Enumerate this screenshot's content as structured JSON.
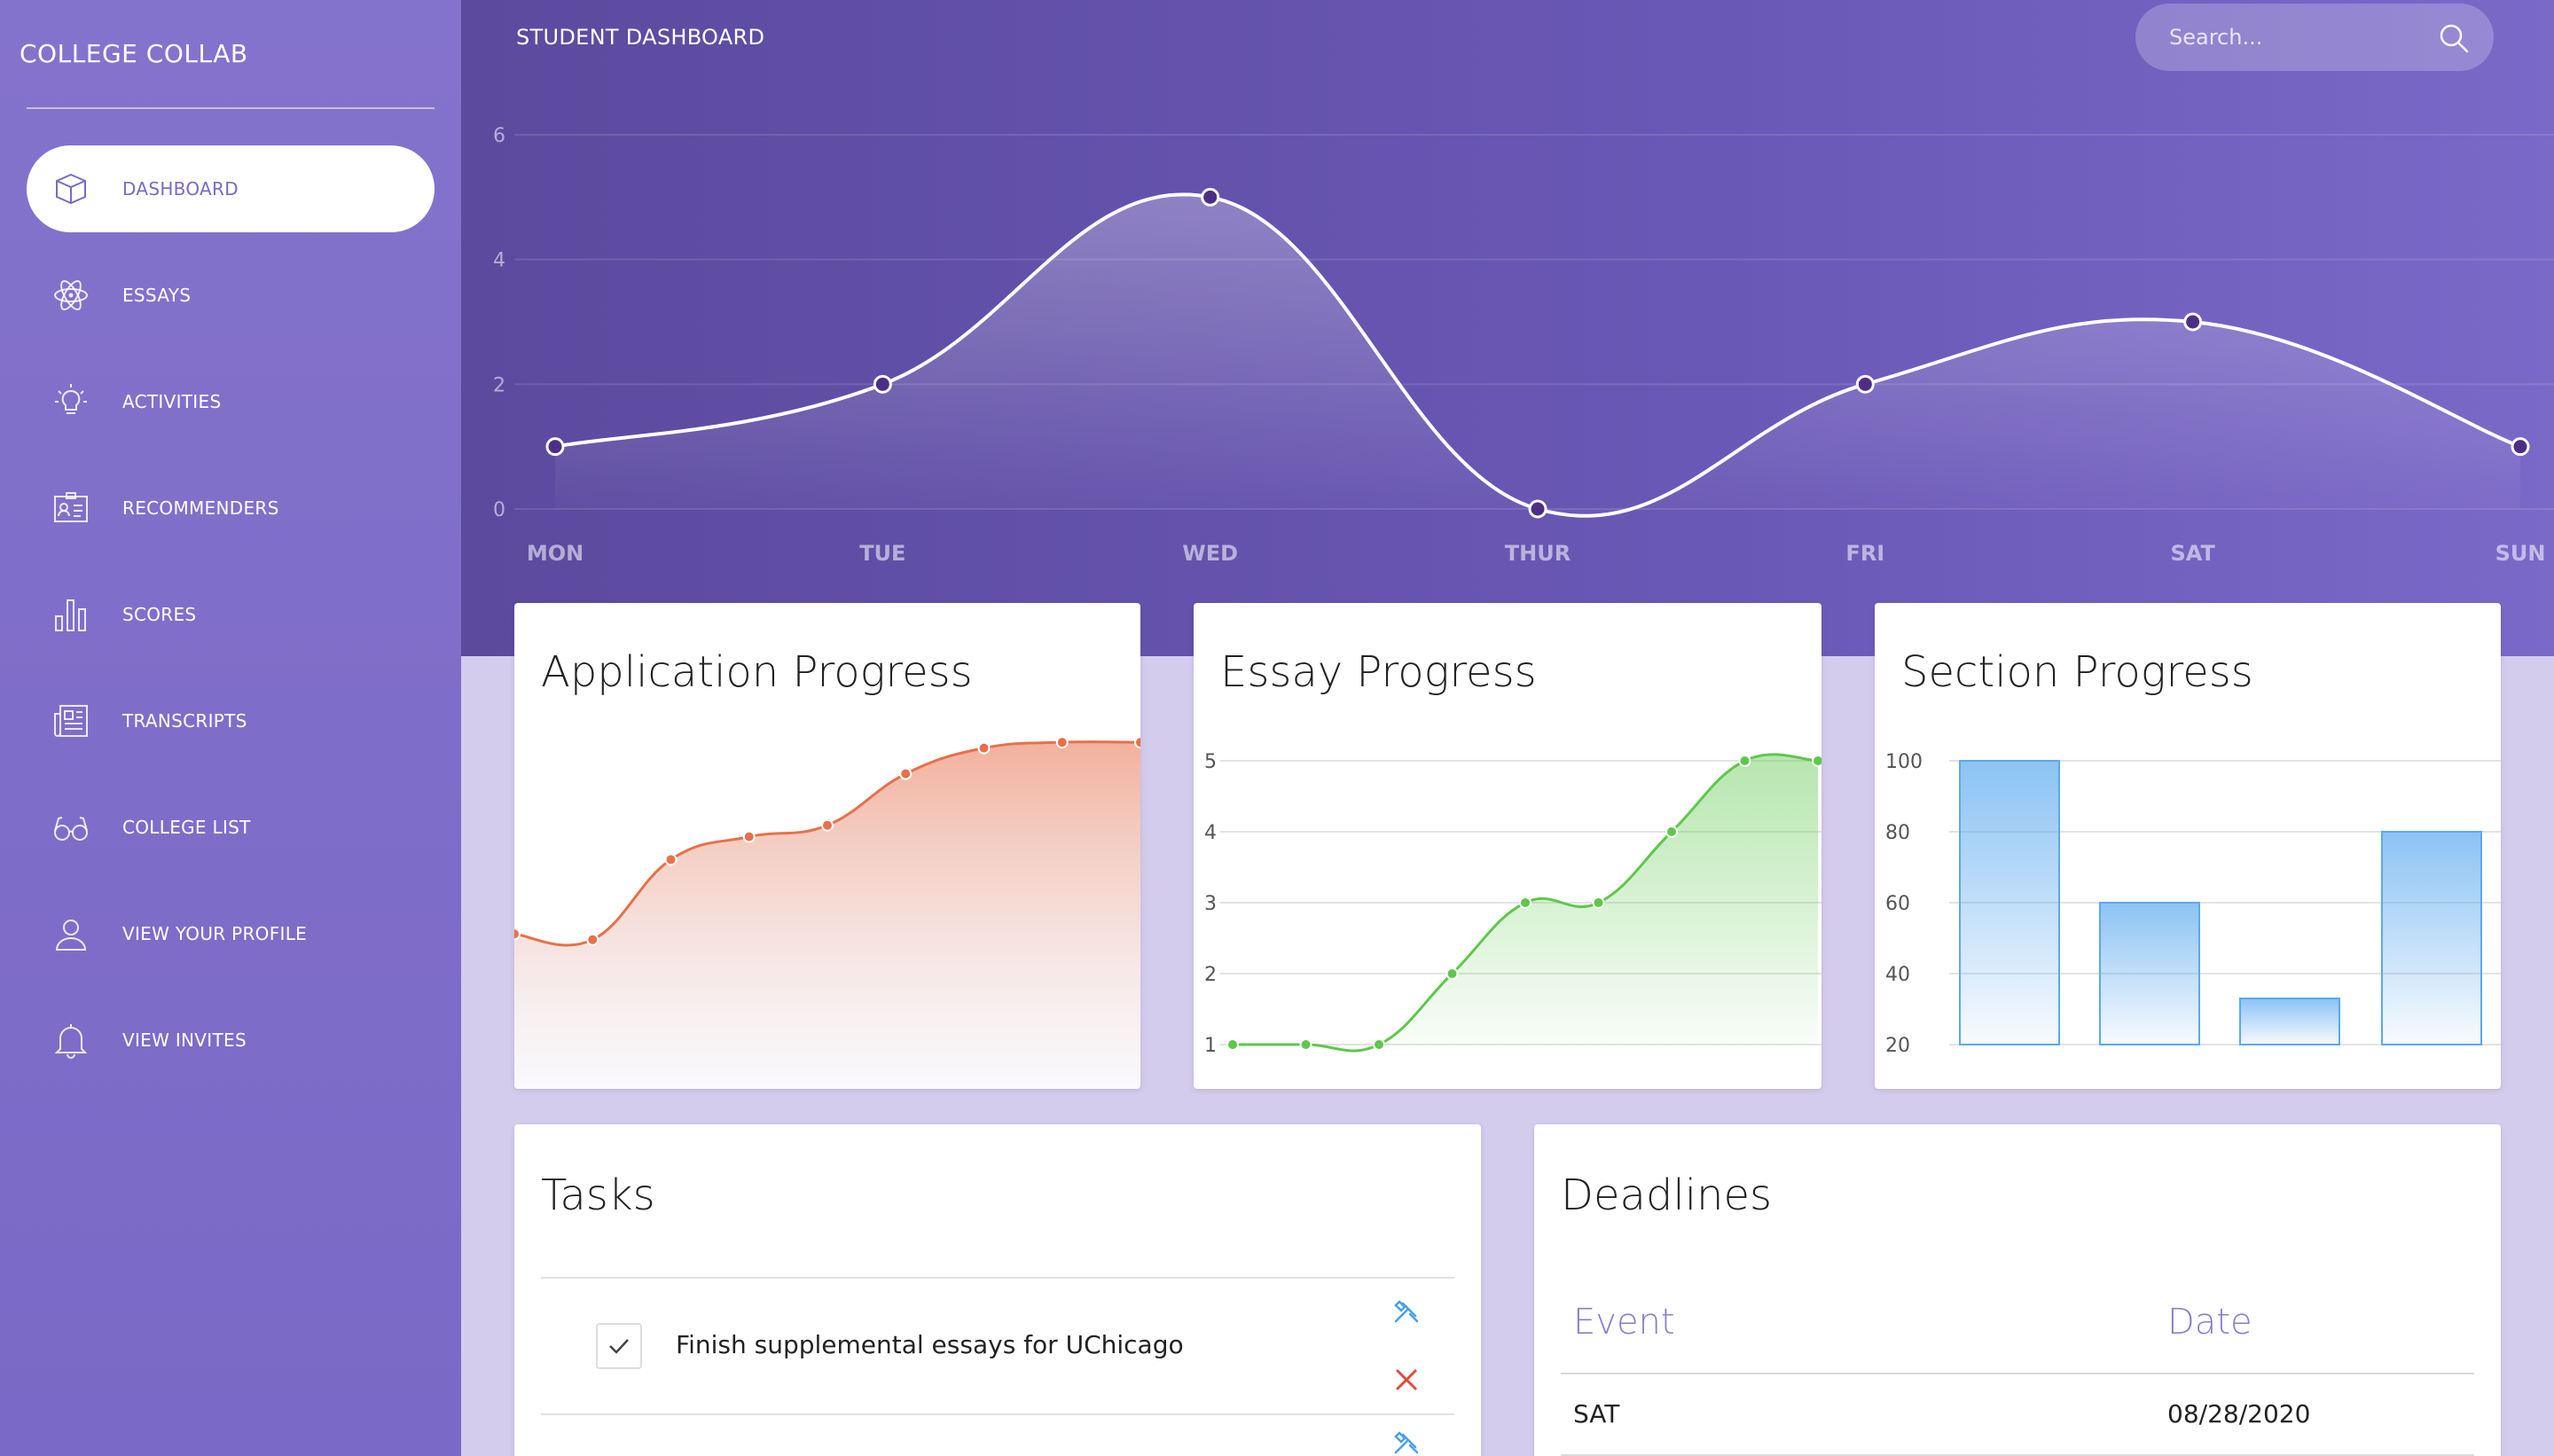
{
  "app": {
    "brand": "COLLEGE COLLAB"
  },
  "sidebar": {
    "items": [
      {
        "label": "DASHBOARD",
        "icon": "box-icon",
        "active": true
      },
      {
        "label": "ESSAYS",
        "icon": "atom-icon"
      },
      {
        "label": "ACTIVITIES",
        "icon": "lightbulb-icon"
      },
      {
        "label": "RECOMMENDERS",
        "icon": "id-card-icon"
      },
      {
        "label": "SCORES",
        "icon": "bar-chart-icon"
      },
      {
        "label": "TRANSCRIPTS",
        "icon": "newspaper-icon"
      },
      {
        "label": "COLLEGE LIST",
        "icon": "glasses-icon"
      },
      {
        "label": "VIEW YOUR PROFILE",
        "icon": "user-icon"
      },
      {
        "label": "VIEW INVITES",
        "icon": "bell-icon"
      }
    ]
  },
  "header": {
    "title": "STUDENT DASHBOARD",
    "search_placeholder": "Search..."
  },
  "colors": {
    "sidebar": "#7a69c6",
    "hero_start": "#5b4a9e",
    "hero_end": "#7b69c8",
    "application_line": "#e8704a",
    "essay_line": "#5dc84a",
    "section_bar": "#5aa9ee"
  },
  "chart_data": [
    {
      "type": "area",
      "title": "",
      "categories": [
        "MON",
        "TUE",
        "WED",
        "THUR",
        "FRI",
        "SAT",
        "SUN"
      ],
      "values": [
        1,
        2,
        5,
        0,
        2,
        3,
        1
      ],
      "yticks": [
        "6",
        "4",
        "2",
        "0"
      ],
      "ylim": [
        0,
        6
      ],
      "grid": true
    },
    {
      "type": "area",
      "title": "Application Progress",
      "values": [
        1.5,
        1.4,
        2.8,
        3.2,
        3.4,
        4.3,
        4.75,
        4.85,
        4.85
      ],
      "ylim": [
        0,
        6
      ],
      "axes_visible": false
    },
    {
      "type": "area",
      "title": "Essay Progress",
      "values": [
        1,
        1,
        1,
        2,
        3,
        3,
        4,
        5,
        5
      ],
      "yticks": [
        "5",
        "4",
        "3",
        "2",
        "1"
      ],
      "ylim": [
        1,
        5
      ],
      "grid": true
    },
    {
      "type": "bar",
      "title": "Section Progress",
      "values": [
        100,
        60,
        33,
        80
      ],
      "yticks": [
        "100",
        "80",
        "60",
        "40",
        "20"
      ],
      "ylim": [
        20,
        100
      ],
      "grid": true
    }
  ],
  "tasks": {
    "title": "Tasks",
    "items": [
      {
        "text": "Finish supplemental essays for UChicago",
        "checked": true
      }
    ]
  },
  "deadlines": {
    "title": "Deadlines",
    "columns": [
      "Event",
      "Date"
    ],
    "rows": [
      {
        "event": "SAT",
        "date": "08/28/2020"
      }
    ]
  }
}
